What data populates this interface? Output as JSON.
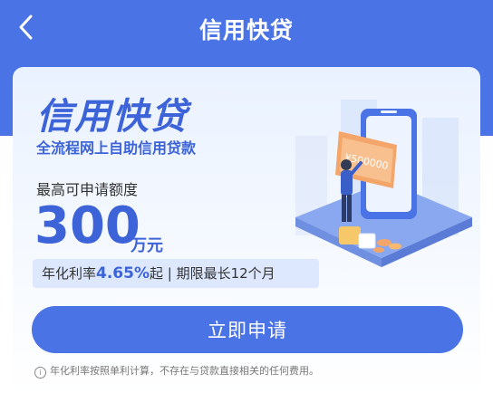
{
  "nav": {
    "title": "信用快贷",
    "back_icon": "chevron-left-icon"
  },
  "hero": {
    "title": "信用快贷",
    "subtitle": "全流程网上自助信用贷款"
  },
  "limit": {
    "label": "最高可申请额度",
    "amount": "300",
    "unit": "万元"
  },
  "rate": {
    "prefix": "年化利率",
    "value": "4.65%",
    "suffix": "起 | 期限最长12个月"
  },
  "illustration": {
    "check_text": "¥500000"
  },
  "apply_button": {
    "label": "立即申请"
  },
  "disclaimer": {
    "icon": "info-icon",
    "text": "年化利率按照单利计算，不存在与贷款直接相关的任何费用。"
  },
  "colors": {
    "brand_blue": "#4a73e6",
    "accent_blue": "#3d63d9",
    "card_bg": "#eaf2ff"
  }
}
